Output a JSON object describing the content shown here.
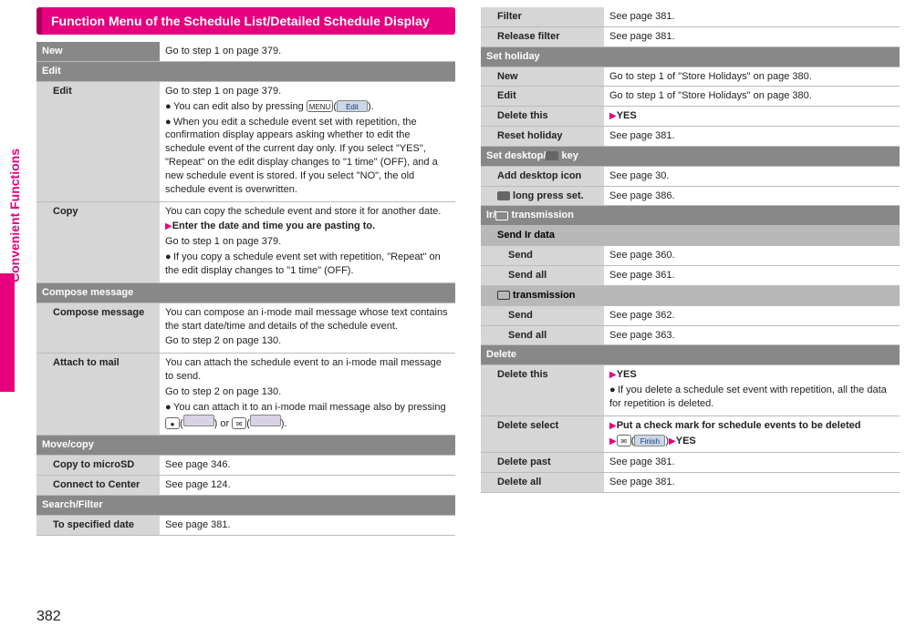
{
  "sidebar_label": "Convenient Functions",
  "page_number": "382",
  "title": "Function Menu of the Schedule List/Detailed Schedule Display",
  "left": {
    "new": {
      "label": "New",
      "desc": "Go to step 1 on page 379."
    },
    "edit_hdr": "Edit",
    "edit": {
      "label": "Edit",
      "p1": "Go to step 1 on page 379.",
      "p2": "You can edit also by pressing ",
      "key2a": "MENU",
      "key2b": "Edit",
      "p2end": ".",
      "p3": "When you edit a schedule event set with repetition, the confirmation display appears asking whether to edit the schedule event of the current day only. If you select \"YES\", \"Repeat\" on the edit display changes to \"1 time\" (OFF), and a new schedule event is stored. If you select \"NO\", the old schedule event is overwritten."
    },
    "copy": {
      "label": "Copy",
      "p1": "You can copy the schedule event and store it for another date.",
      "p2": "Enter the date and time you are pasting to.",
      "p3": "Go to step 1 on page 379.",
      "p4": "If you copy a schedule event set with repetition, \"Repeat\" on the edit display changes to \"1 time\" (OFF)."
    },
    "compose_hdr": "Compose message",
    "compose": {
      "label": "Compose message",
      "p1": "You can compose an i-mode mail message whose text contains the start date/time and details of the schedule event.",
      "p2": "Go to step 2 on page 130."
    },
    "attach": {
      "label": "Attach to mail",
      "p1": "You can attach the schedule event to an i-mode mail message to send.",
      "p2": "Go to step 2 on page 130.",
      "p3a": "You can attach it to an i-mode mail message also by pressing ",
      "key3a": "●",
      "soft3a": " ",
      "mid": " or ",
      "key3b": "✉",
      "soft3b": " ",
      "p3end": "."
    },
    "movecopy_hdr": "Move/copy",
    "microsd": {
      "label": "Copy to microSD",
      "desc": "See page 346."
    },
    "center": {
      "label": "Connect to Center",
      "desc": "See page 124."
    },
    "searchfilter_hdr": "Search/Filter",
    "tospec": {
      "label": "To specified date",
      "desc": "See page 381."
    }
  },
  "right": {
    "filter": {
      "label": "Filter",
      "desc": "See page 381."
    },
    "release": {
      "label": "Release filter",
      "desc": "See page 381."
    },
    "setholiday_hdr": "Set holiday",
    "hnew": {
      "label": "New",
      "desc": "Go to step 1 of \"Store Holidays\" on page 380."
    },
    "hedit": {
      "label": "Edit",
      "desc": "Go to step 1 of \"Store Holidays\" on page 380."
    },
    "hdel": {
      "label": "Delete this",
      "yes": "YES"
    },
    "hreset": {
      "label": "Reset holiday",
      "desc": "See page 381."
    },
    "setdesktop_hdr_a": "Set desktop/",
    "setdesktop_hdr_b": " key",
    "deskicon": {
      "label": "Add desktop icon",
      "desc": "See page 30."
    },
    "longpress": {
      "label": " long press set.",
      "desc": "See page 386."
    },
    "irtrans_hdr_a": "Ir/",
    "irtrans_hdr_b": " transmission",
    "sendir_hdr": "Send Ir data",
    "ir_send": {
      "label": "Send",
      "desc": "See page 360."
    },
    "ir_sendall": {
      "label": "Send all",
      "desc": "See page 361."
    },
    "ictrans_hdr": " transmission",
    "ic_send": {
      "label": "Send",
      "desc": "See page 362."
    },
    "ic_sendall": {
      "label": "Send all",
      "desc": "See page 363."
    },
    "delete_hdr": "Delete",
    "delthis": {
      "label": "Delete this",
      "yes": "YES",
      "note": "If you delete a schedule set event with repetition, all the data for repetition is deleted."
    },
    "delselect": {
      "label": "Delete select",
      "p1": "Put a check mark for schedule events to be deleted",
      "key": "✉",
      "soft": "Finish",
      "yes": "YES"
    },
    "delpast": {
      "label": "Delete past",
      "desc": "See page 381."
    },
    "delall": {
      "label": "Delete all",
      "desc": "See page 381."
    }
  }
}
